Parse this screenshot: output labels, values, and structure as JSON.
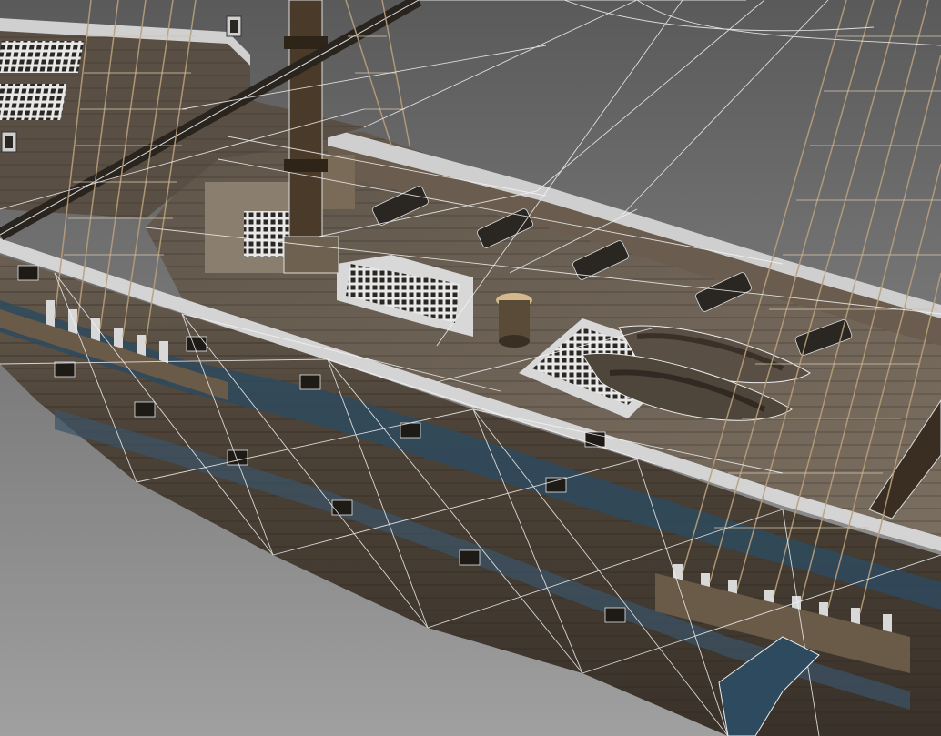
{
  "viewport": {
    "background_top": "#5c5c5c",
    "background_bottom": "#9a9a9a"
  },
  "colors": {
    "wood_dark": "#3b332b",
    "wood_mid": "#5e5347",
    "wood_light": "#8a7e6e",
    "deck": "#6f6458",
    "hull_blue": "#2e4a5e",
    "wire": "#f2f2f2",
    "rope": "#b89f7c",
    "rail_white": "#d9d9d9",
    "mast": "#4a3a2a"
  },
  "icons": {
    "lantern": "lantern-icon",
    "cannon": "cannon-icon",
    "capstan": "capstan-icon",
    "rowboat": "rowboat-icon",
    "hatch_grate": "grate-icon"
  }
}
